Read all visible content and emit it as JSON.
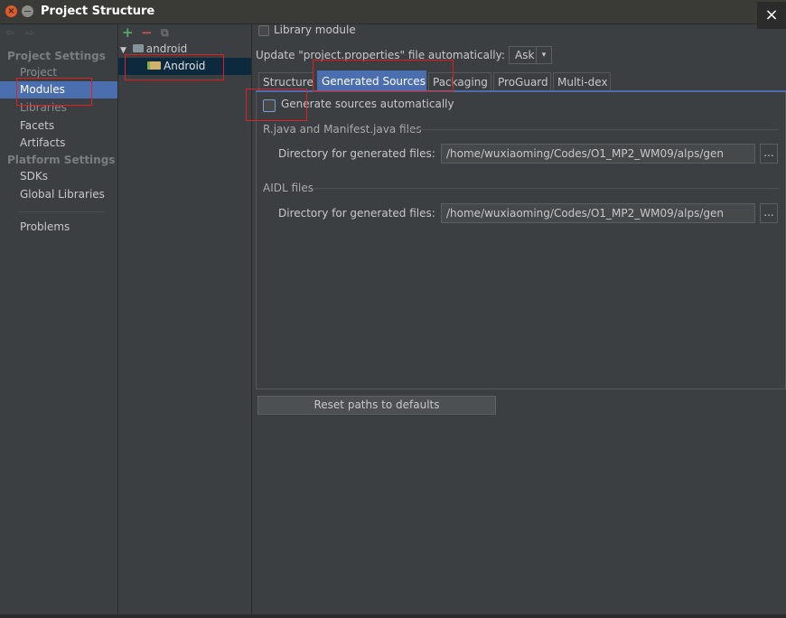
{
  "window": {
    "title": "Project Structure",
    "close_symbol": "×",
    "close_circle_symbol": "×"
  },
  "nav": {
    "back_icon": "⇦",
    "forward_icon": "⇨",
    "project_settings_header": "Project Settings",
    "project_settings_items": [
      "Project",
      "Modules",
      "Libraries",
      "Facets",
      "Artifacts"
    ],
    "selected_item": "Modules",
    "platform_settings_header": "Platform Settings",
    "platform_settings_items": [
      "SDKs",
      "Global Libraries"
    ],
    "problems": "Problems"
  },
  "tree": {
    "add_icon": "+",
    "remove_icon": "−",
    "copy_icon": "⧉",
    "root_label": "android",
    "child_label": "Android",
    "expand_icon": "▼"
  },
  "options": {
    "library_module_label": "Library module",
    "update_label": "Update \"project.properties\" file automatically:",
    "update_value": "Ask",
    "dropdown_icon": "▾"
  },
  "tabs": [
    "Structure",
    "Generated Sources",
    "Packaging",
    "ProGuard",
    "Multi-dex"
  ],
  "selected_tab": "Generated Sources",
  "generated": {
    "auto_label": "Generate sources automatically",
    "rjava_section": "R.java and Manifest.java files",
    "rjava_dir_label": "Directory for generated files:",
    "rjava_dir_value": "/home/wuxiaoming/Codes/O1_MP2_WM09/alps/gen",
    "aidl_section": "AIDL files",
    "aidl_dir_label": "Directory for generated files:",
    "aidl_dir_value": "/home/wuxiaoming/Codes/O1_MP2_WM09/alps/gen",
    "browse_label": "...",
    "reset_button": "Reset paths to defaults"
  },
  "colors": {
    "background": "#3c3f41",
    "selection": "#4b6eaf",
    "tree_selection": "#0d293e",
    "highlight_box": "#e02020",
    "add_green": "#59a869",
    "remove_red": "#c75450"
  }
}
